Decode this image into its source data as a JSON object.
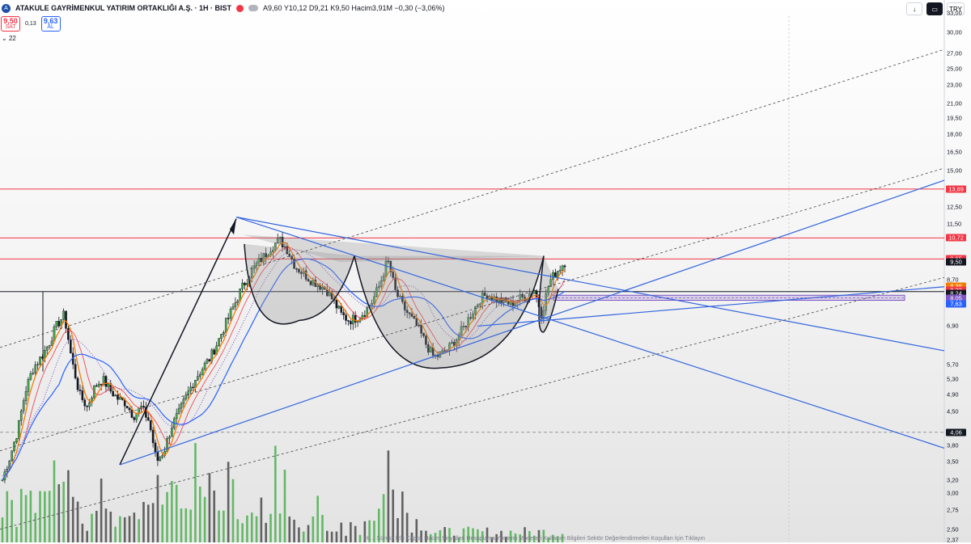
{
  "header": {
    "logo_letter": "A",
    "title": "ATAKULE GAYRİMENKUL YATIRIM ORTAKLIĞI A.Ş. · 1H · BIST",
    "ohlc": "A9,60  Y10,12  D9,21  K9,50  Hacim3,91M  −0,30 (−3,06%)"
  },
  "trade": {
    "sell_price": "9,50",
    "sell_label": "SAT",
    "spread": "0,13",
    "buy_price": "9,63",
    "buy_label": "AL"
  },
  "indicator_row": "22",
  "top_right": {
    "download_icon": "↓",
    "currency": "TRY"
  },
  "price_axis": {
    "ticks": [
      "33,00",
      "30,00",
      "27,00",
      "25,00",
      "23,00",
      "21,00",
      "19,50",
      "18,00",
      "16,50",
      "15,00",
      "12,50",
      "11,50",
      "8,70",
      "6,90",
      "5,70",
      "5,30",
      "4,90",
      "4,50",
      "3,80",
      "3,50",
      "3,20",
      "3,00",
      "2,75",
      "2,50",
      "2,37"
    ]
  },
  "price_tags": [
    {
      "text": "13,69",
      "color": "#f23645"
    },
    {
      "text": "10,72",
      "color": "#f23645"
    },
    {
      "text": "9,65",
      "color": "#f23645"
    },
    {
      "text": "9,50",
      "color": "#131722"
    },
    {
      "text": "8,36",
      "color": "#f57c00"
    },
    {
      "text": "8,32",
      "color": "#f23645"
    },
    {
      "text": "8,24",
      "color": "#131722"
    },
    {
      "text": "8,05",
      "color": "#7e57c2"
    },
    {
      "text": "7,63",
      "color": "#2962ff"
    },
    {
      "text": "4,06",
      "color": "#131722"
    }
  ],
  "chart_data": {
    "type": "candlestick",
    "symbol": "ATAKULE",
    "interval": "1H",
    "y_scale": "log",
    "ylim": [
      2.37,
      33.0
    ],
    "last_close": 9.5,
    "horizontal_levels": [
      13.69,
      10.72,
      9.65,
      8.2
    ],
    "zone": [
      7.9,
      8.0
    ],
    "crosshair_price": 4.06,
    "close_path": [
      3.2,
      3.6,
      4.1,
      5.0,
      5.6,
      5.9,
      6.3,
      6.9,
      7.3,
      5.8,
      4.9,
      4.6,
      5.1,
      5.3,
      5.0,
      4.8,
      4.7,
      4.4,
      4.6,
      4.3,
      3.5,
      3.7,
      4.2,
      4.5,
      4.9,
      5.3,
      5.6,
      5.9,
      6.4,
      7.0,
      7.6,
      8.3,
      8.9,
      9.4,
      9.8,
      10.3,
      10.6,
      10.1,
      9.3,
      9.0,
      8.7,
      8.5,
      8.3,
      7.8,
      7.3,
      7.1,
      7.2,
      7.4,
      7.8,
      8.5,
      9.6,
      8.2,
      7.6,
      7.2,
      6.8,
      6.3,
      5.9,
      6.0,
      6.2,
      6.5,
      6.9,
      7.4,
      7.9,
      8.1,
      7.9,
      7.8,
      7.7,
      7.9,
      8.0,
      8.3,
      7.3,
      8.6,
      9.1,
      9.5
    ],
    "volume_path": [
      0.4,
      0.3,
      0.5,
      0.6,
      0.4,
      0.5,
      0.7,
      0.4,
      0.8,
      0.3,
      0.2,
      0.4,
      0.5,
      0.3,
      0.2,
      0.3,
      0.4,
      0.2,
      0.3,
      0.5,
      0.6,
      0.4,
      0.5,
      0.4,
      0.3,
      0.9,
      0.5,
      0.4,
      0.3,
      0.7,
      0.4,
      0.3,
      0.2,
      0.3,
      0.2,
      1.0,
      0.5,
      0.3,
      0.2,
      0.2,
      0.3,
      0.2,
      0.1,
      0.2,
      0.1,
      0.2,
      0.1,
      0.2,
      0.3,
      0.4,
      0.9,
      0.5,
      0.3,
      0.2,
      0.2,
      0.1,
      0.1,
      0.1,
      0.1,
      0.1,
      0.1,
      0.1,
      0.1,
      0.1,
      0.1,
      0.1,
      0.1,
      0.1,
      0.1,
      0.1,
      0.1,
      0.1,
      0.1,
      0.1
    ]
  },
  "bottom_text": "Hi…  Sürekli İzle Çapral Hacim Sinyalleri Hesaplama Yöntemi Modelleri Kullanım Bilgileri Sektör Değerlendirmeleri Koşulları İçin Tıklayın"
}
